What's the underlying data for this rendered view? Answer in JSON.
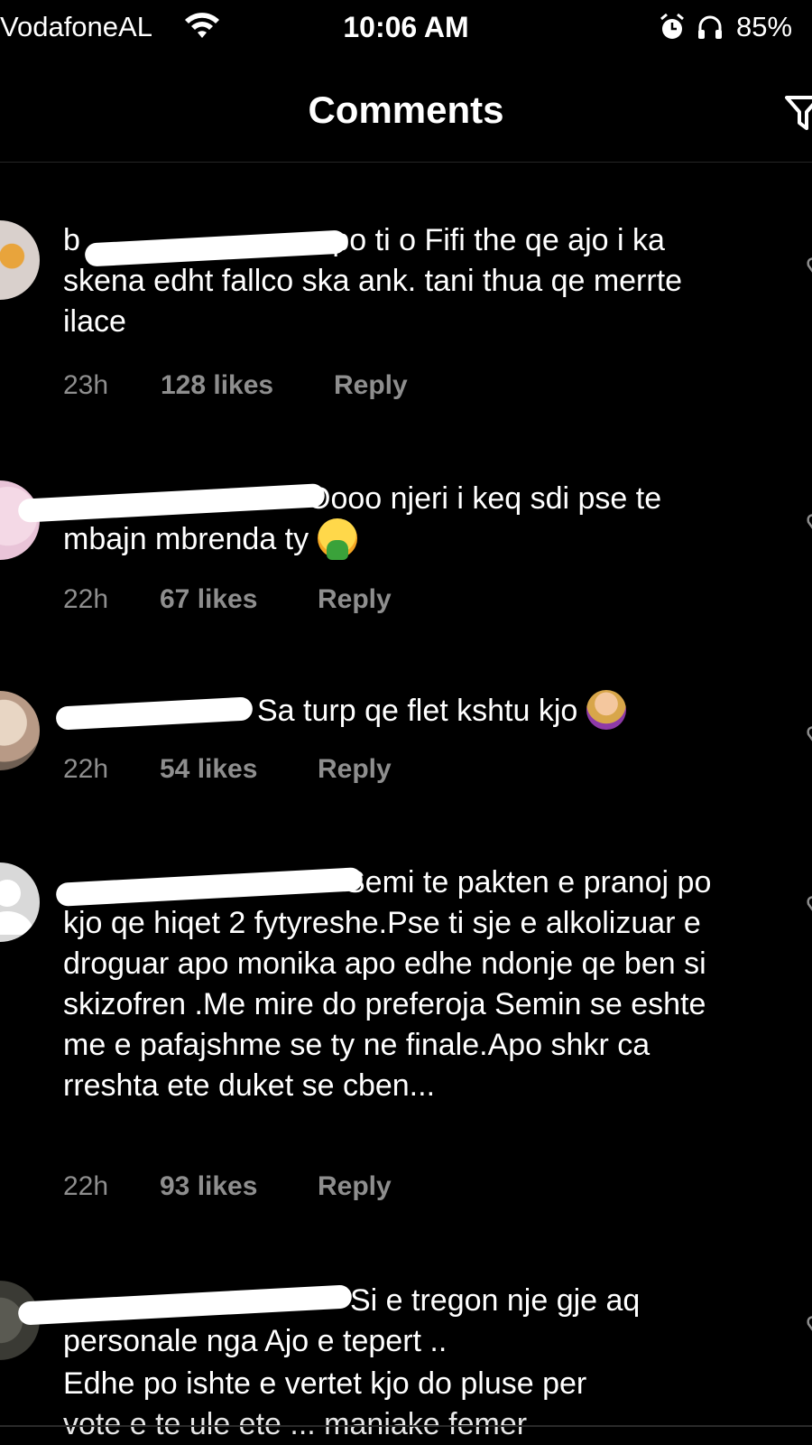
{
  "status_bar": {
    "carrier": "VodafoneAL",
    "time": "10:06 AM",
    "battery": "85%"
  },
  "header": {
    "title": "Comments"
  },
  "comments": [
    {
      "username": "b",
      "text": "po ti o Fifi the qe ajo i ka skena edht fallco ska ank. tani thua qe merrte ilace",
      "age": "23h",
      "likes": "128 likes",
      "reply": "Reply"
    },
    {
      "username": "",
      "text": "Oooo njeri i keq sdi pse te mbajn mbrenda ty",
      "age": "22h",
      "likes": "67 likes",
      "reply": "Reply"
    },
    {
      "username": "",
      "text": "Sa turp qe flet kshtu kjo",
      "age": "22h",
      "likes": "54 likes",
      "reply": "Reply"
    },
    {
      "username": "",
      "text": "Semi te pakten e pranoj po kjo qe hiqet 2 fytyreshe.Pse ti sje e alkolizuar e droguar apo monika apo edhe ndonje qe ben si skizofren .Me mire do preferoja Semin se eshte me e pafajshme se ty ne finale.Apo shkr ca rreshta ete duket se cben...",
      "age": "22h",
      "likes": "93 likes",
      "reply": "Reply"
    },
    {
      "username": "",
      "text": "Si e tregon nje gje aq personale nga Ajo e tepert ..",
      "text2": "Edhe po ishte e vertet kjo do pluse per",
      "text3": "vote e te ule ete ... maniake femer"
    }
  ]
}
